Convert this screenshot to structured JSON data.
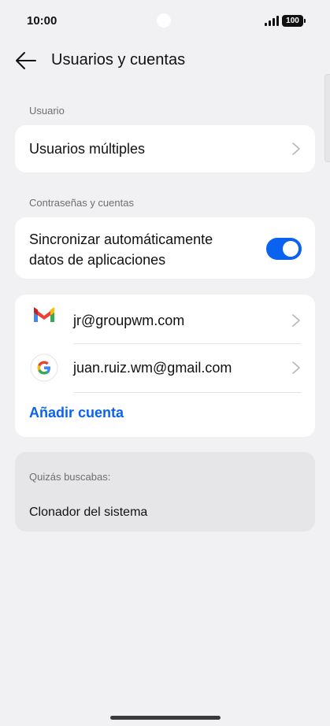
{
  "status_bar": {
    "time": "10:00",
    "battery": "100"
  },
  "header": {
    "title": "Usuarios y cuentas"
  },
  "sections": {
    "user_label": "Usuario",
    "passwords_label": "Contraseñas y cuentas"
  },
  "users": {
    "multiple_users": "Usuarios múltiples"
  },
  "sync": {
    "line1": "Sincronizar automáticamente",
    "line2": "datos de aplicaciones",
    "enabled": true
  },
  "accounts": [
    {
      "email": "jr@groupwm.com",
      "icon": "gmail-icon"
    },
    {
      "email": "juan.ruiz.wm@gmail.com",
      "icon": "google-icon"
    }
  ],
  "add_account": "Añadir cuenta",
  "suggestions": {
    "label": "Quizás buscabas:",
    "item": "Clonador del sistema"
  },
  "colors": {
    "accent": "#0a63f0",
    "background": "#f1f1f3",
    "card": "#ffffff"
  }
}
